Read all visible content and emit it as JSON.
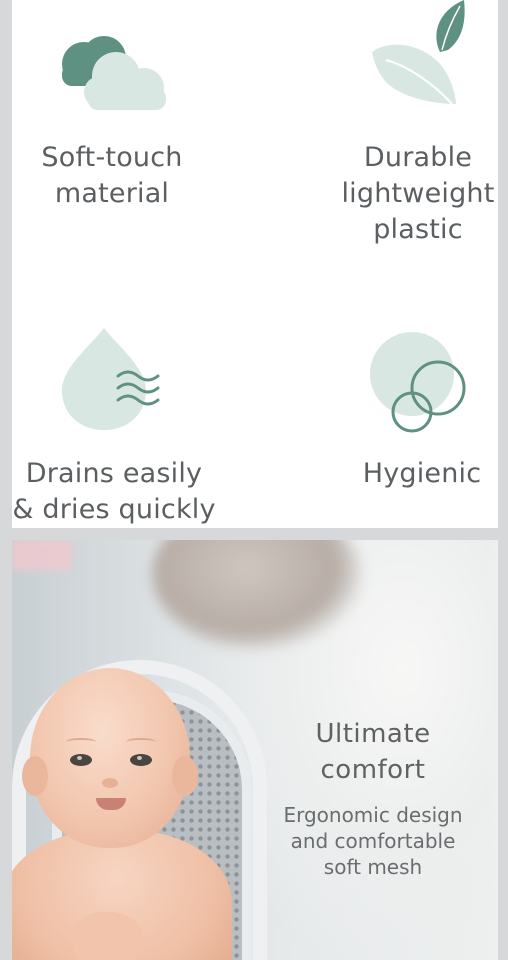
{
  "colors": {
    "accent_dark": "#5f9183",
    "accent_light": "#d9e7e2",
    "text": "#5b5f61"
  },
  "features": [
    {
      "label": "Soft-touch\nmaterial",
      "icon": "cloud-icon"
    },
    {
      "label": "Durable\nlightweight\nplastic",
      "icon": "leaf-icon"
    },
    {
      "label": "Drains easily\n& dries quickly",
      "icon": "water-drop-icon"
    },
    {
      "label": "Hygienic",
      "icon": "bubbles-icon"
    }
  ],
  "promo": {
    "title": "Ultimate\ncomfort",
    "subtitle": "Ergonomic design\nand comfortable\nsoft mesh"
  }
}
